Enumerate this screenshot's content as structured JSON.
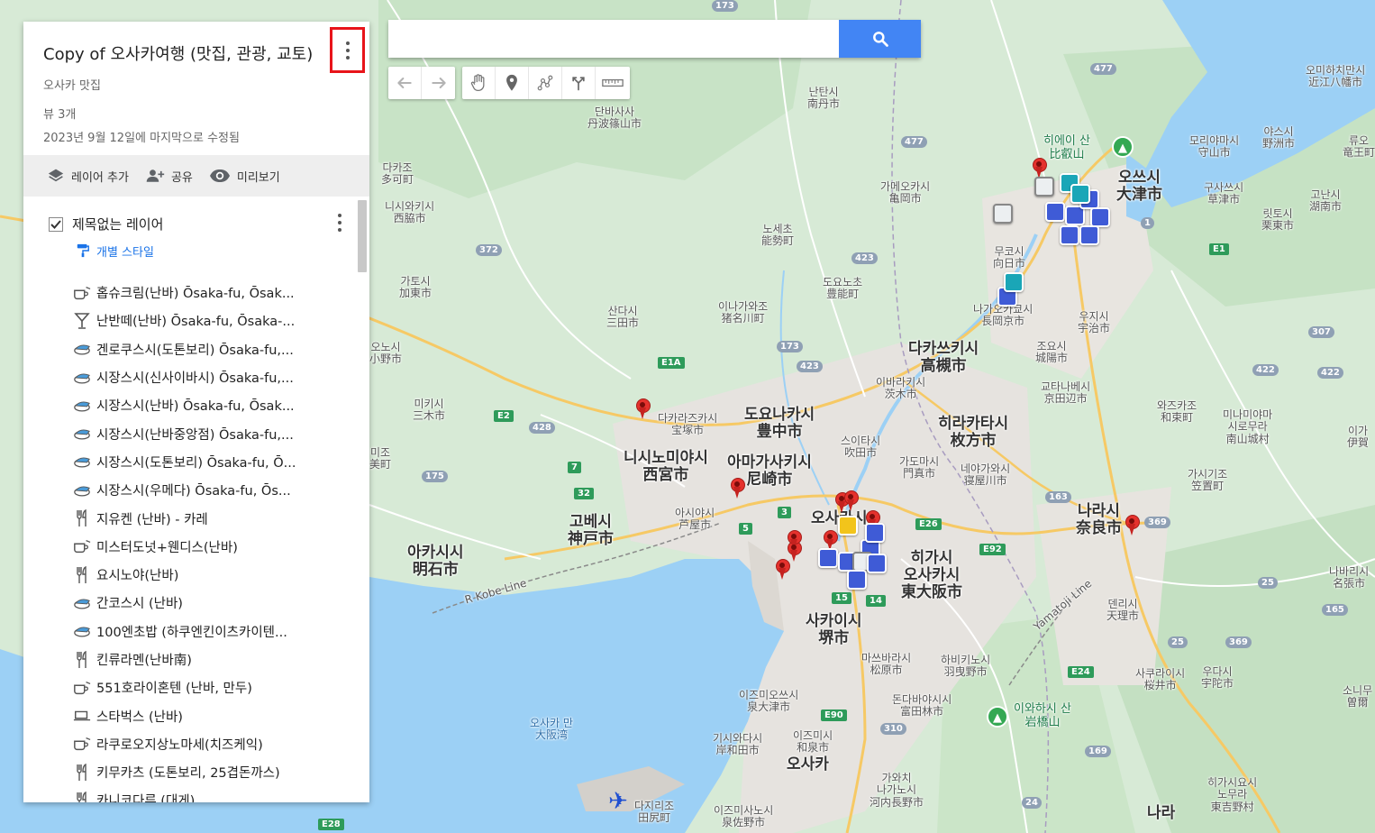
{
  "map_title": "Copy of 오사카여행 (맛집, 관광, 교토)",
  "map_description": "오사카 맛집",
  "view_count": "뷰 3개",
  "last_modified": "2023년 9월 12일에 마지막으로 수정됨",
  "actions": {
    "add_layer": "레이어 추가",
    "share": "공유",
    "preview": "미리보기"
  },
  "layer": {
    "name": "제목없는 레이어",
    "style_link": "개별 스타일",
    "checked": true
  },
  "places": [
    {
      "name": "홉슈크림(난바) Ōsaka-fu, Ōsak...",
      "icon": "coffee-cup-icon"
    },
    {
      "name": "난반떼(난바) Ōsaka-fu, Ōsaka-...",
      "icon": "cocktail-icon"
    },
    {
      "name": "겐로쿠스시(도톤보리) Ōsaka-fu,...",
      "icon": "sushi-icon"
    },
    {
      "name": "시장스시(신사이바시) Ōsaka-fu,...",
      "icon": "sushi-icon"
    },
    {
      "name": "시장스시(난바) Ōsaka-fu, Ōsak...",
      "icon": "sushi-icon"
    },
    {
      "name": "시장스시(난바중앙점) Ōsaka-fu,...",
      "icon": "sushi-icon"
    },
    {
      "name": "시장스시(도톤보리) Ōsaka-fu, Ō...",
      "icon": "sushi-icon"
    },
    {
      "name": "시장스시(우메다) Ōsaka-fu, Ōs...",
      "icon": "sushi-icon"
    },
    {
      "name": "지유켄 (난바) - 카레",
      "icon": "fork-knife-icon"
    },
    {
      "name": "미스터도넛+웬디스(난바)",
      "icon": "coffee-cup-icon"
    },
    {
      "name": "요시노야(난바)",
      "icon": "fork-knife-icon"
    },
    {
      "name": "간코스시 (난바)",
      "icon": "sushi-icon"
    },
    {
      "name": "100엔초밥 (하쿠엔킨이츠카이텐...",
      "icon": "sushi-icon"
    },
    {
      "name": "킨류라멘(난바南)",
      "icon": "fork-knife-icon"
    },
    {
      "name": "551호라이혼텐 (난바, 만두)",
      "icon": "coffee-cup-icon"
    },
    {
      "name": "스타벅스 (난바)",
      "icon": "cafe-icon"
    },
    {
      "name": "라쿠로오지상노마세(치즈케익)",
      "icon": "coffee-cup-icon"
    },
    {
      "name": "키무카츠 (도톤보리, 25겹돈까스)",
      "icon": "fork-knife-icon"
    },
    {
      "name": "카니코다루 (대게)",
      "icon": "fork-knife-icon"
    }
  ],
  "search": {
    "placeholder": "",
    "value": ""
  },
  "map": {
    "labels": [
      {
        "text": "단바사사\n丹波篠山市",
        "cls": "small"
      },
      {
        "text": "난탄시\n南丹市",
        "cls": "small"
      },
      {
        "text": "가메오카시\n亀岡市",
        "cls": "small"
      },
      {
        "text": "다카조\n多可町",
        "cls": "small"
      },
      {
        "text": "니시와키시\n西脇市",
        "cls": "small"
      },
      {
        "text": "노세초\n能勢町",
        "cls": "small"
      },
      {
        "text": "도요노초\n豊能町",
        "cls": "small"
      },
      {
        "text": "가토시\n加東市",
        "cls": "small"
      },
      {
        "text": "산다시\n三田市",
        "cls": "small"
      },
      {
        "text": "이나가와조\n猪名川町",
        "cls": "small"
      },
      {
        "text": "오노시\n小野市",
        "cls": "small"
      },
      {
        "text": "미키시\n三木市",
        "cls": "small"
      },
      {
        "text": "다카라즈카시\n宝塚市",
        "cls": "small"
      },
      {
        "text": "도요나카시\n豊中市",
        "cls": "big"
      },
      {
        "text": "니시노미야시\n西宮市",
        "cls": "big"
      },
      {
        "text": "아마가사키시\n尼崎市",
        "cls": "big"
      },
      {
        "text": "아시야시\n芦屋市",
        "cls": "small"
      },
      {
        "text": "고베시\n神戸市",
        "cls": "big"
      },
      {
        "text": "아카시시\n明石市",
        "cls": "big"
      },
      {
        "text": "미조\n美町",
        "cls": "small"
      },
      {
        "text": "다카쓰키시\n高槻市",
        "cls": "big"
      },
      {
        "text": "이바라키시\n茨木市",
        "cls": "small"
      },
      {
        "text": "스이타시\n吹田市",
        "cls": "small"
      },
      {
        "text": "히라카타시\n枚方市",
        "cls": "big"
      },
      {
        "text": "가도마시\n門真市",
        "cls": "small"
      },
      {
        "text": "네야가와시\n寝屋川市",
        "cls": "small"
      },
      {
        "text": "오사카시",
        "cls": "big"
      },
      {
        "text": "히가시\n오사카시\n東大阪市",
        "cls": "big"
      },
      {
        "text": "사카이시\n堺市",
        "cls": "big"
      },
      {
        "text": "마쓰바라시\n松原市",
        "cls": "small"
      },
      {
        "text": "하비키노시\n羽曳野市",
        "cls": "small"
      },
      {
        "text": "이즈미오쓰시\n泉大津市",
        "cls": "small"
      },
      {
        "text": "돈다바야시시\n富田林市",
        "cls": "small"
      },
      {
        "text": "기시와다시\n岸和田市",
        "cls": "small"
      },
      {
        "text": "이즈미시\n和泉市",
        "cls": "small"
      },
      {
        "text": "오사카",
        "cls": "big"
      },
      {
        "text": "가와치\n나가노시\n河内長野市",
        "cls": "small"
      },
      {
        "text": "이즈미사노시\n泉佐野市",
        "cls": "small"
      },
      {
        "text": "다지리조\n田尻町",
        "cls": "small"
      },
      {
        "text": "오사카 만\n大阪湾",
        "cls": "water"
      },
      {
        "text": "나라시\n奈良市",
        "cls": "big"
      },
      {
        "text": "덴리시\n天理市",
        "cls": "small"
      },
      {
        "text": "가시기조\n笠置町",
        "cls": "small"
      },
      {
        "text": "와즈카조\n和束町",
        "cls": "small"
      },
      {
        "text": "미나미야마\n시로무라\n南山城村",
        "cls": "small"
      },
      {
        "text": "우다시\n宇陀市",
        "cls": "small"
      },
      {
        "text": "사쿠라이시\n桜井市",
        "cls": "small"
      },
      {
        "text": "히가시요시\n노무라\n東吉野村",
        "cls": "small"
      },
      {
        "text": "나라",
        "cls": "big"
      },
      {
        "text": "오쓰시\n大津市",
        "cls": "big"
      },
      {
        "text": "모리야마시\n守山市",
        "cls": "small"
      },
      {
        "text": "야스시\n野洲市",
        "cls": "small"
      },
      {
        "text": "구사쓰시\n草津市",
        "cls": "small"
      },
      {
        "text": "릿토시\n栗東市",
        "cls": "small"
      },
      {
        "text": "고난시\n湖南市",
        "cls": "small"
      },
      {
        "text": "오미하치만시\n近江八幡市",
        "cls": "small"
      },
      {
        "text": "류오\n竜王町",
        "cls": "small"
      },
      {
        "text": "무코시\n向日市",
        "cls": "small"
      },
      {
        "text": "나가오카쿄시\n長岡京市",
        "cls": "small"
      },
      {
        "text": "우지시\n宇治市",
        "cls": "small"
      },
      {
        "text": "조요시\n城陽市",
        "cls": "small"
      },
      {
        "text": "교타나베시\n京田辺市",
        "cls": "small"
      },
      {
        "text": "히에이 산\n比叡山",
        "cls": "park"
      },
      {
        "text": "이와하시 산\n岩橋山",
        "cls": "park"
      },
      {
        "text": "나바리시\n名張市",
        "cls": "small"
      },
      {
        "text": "이가\n伊賀",
        "cls": "small"
      },
      {
        "text": "소니무\n曽爾",
        "cls": "small"
      },
      {
        "text": "R Kobe Line",
        "cls": "small"
      },
      {
        "text": "Yamatoji Line",
        "cls": "small"
      }
    ],
    "road_shields": [
      "173",
      "477",
      "477",
      "372",
      "423",
      "173",
      "423",
      "E1A",
      "E2",
      "428",
      "175",
      "7",
      "32",
      "3",
      "5",
      "E26",
      "E92",
      "163",
      "369",
      "25",
      "15",
      "14",
      "E90",
      "310",
      "24",
      "169",
      "E28",
      "E24",
      "307",
      "422",
      "422",
      "1",
      "E1",
      "165",
      "369",
      "25"
    ]
  }
}
